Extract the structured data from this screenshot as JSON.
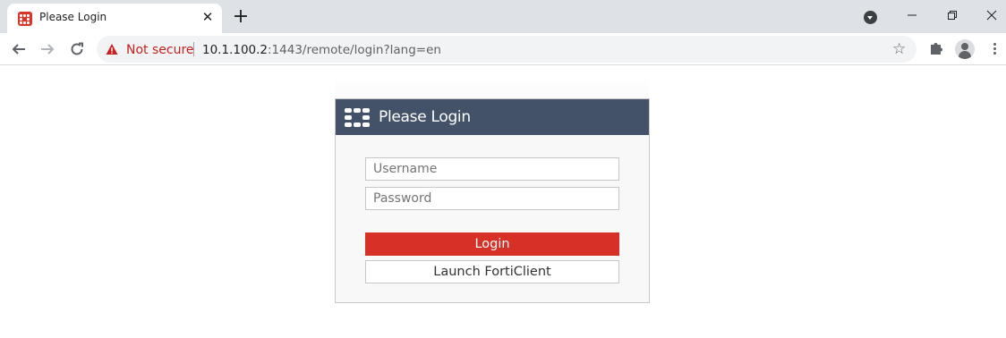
{
  "browser": {
    "tab_title": "Please Login",
    "tab_close": "✕",
    "new_tab": "+",
    "security_label": "Not secure",
    "url_host": "10.1.100.2",
    "url_path": ":1443/remote/login?lang=en",
    "icons": {
      "favicon": "fortinet-favicon-icon",
      "back": "back-arrow-icon",
      "forward": "forward-arrow-icon",
      "reload": "reload-icon",
      "warning": "warning-triangle-icon",
      "bookmark": "star-icon",
      "extensions": "puzzle-icon",
      "profile": "profile-icon",
      "menu": "kebab-menu-icon"
    }
  },
  "login": {
    "title": "Please Login",
    "username_placeholder": "Username",
    "password_placeholder": "Password",
    "login_label": "Login",
    "forticlient_label": "Launch FortiClient"
  },
  "colors": {
    "header": "#435269",
    "login_button": "#d63027",
    "not_secure": "#c5221f"
  }
}
